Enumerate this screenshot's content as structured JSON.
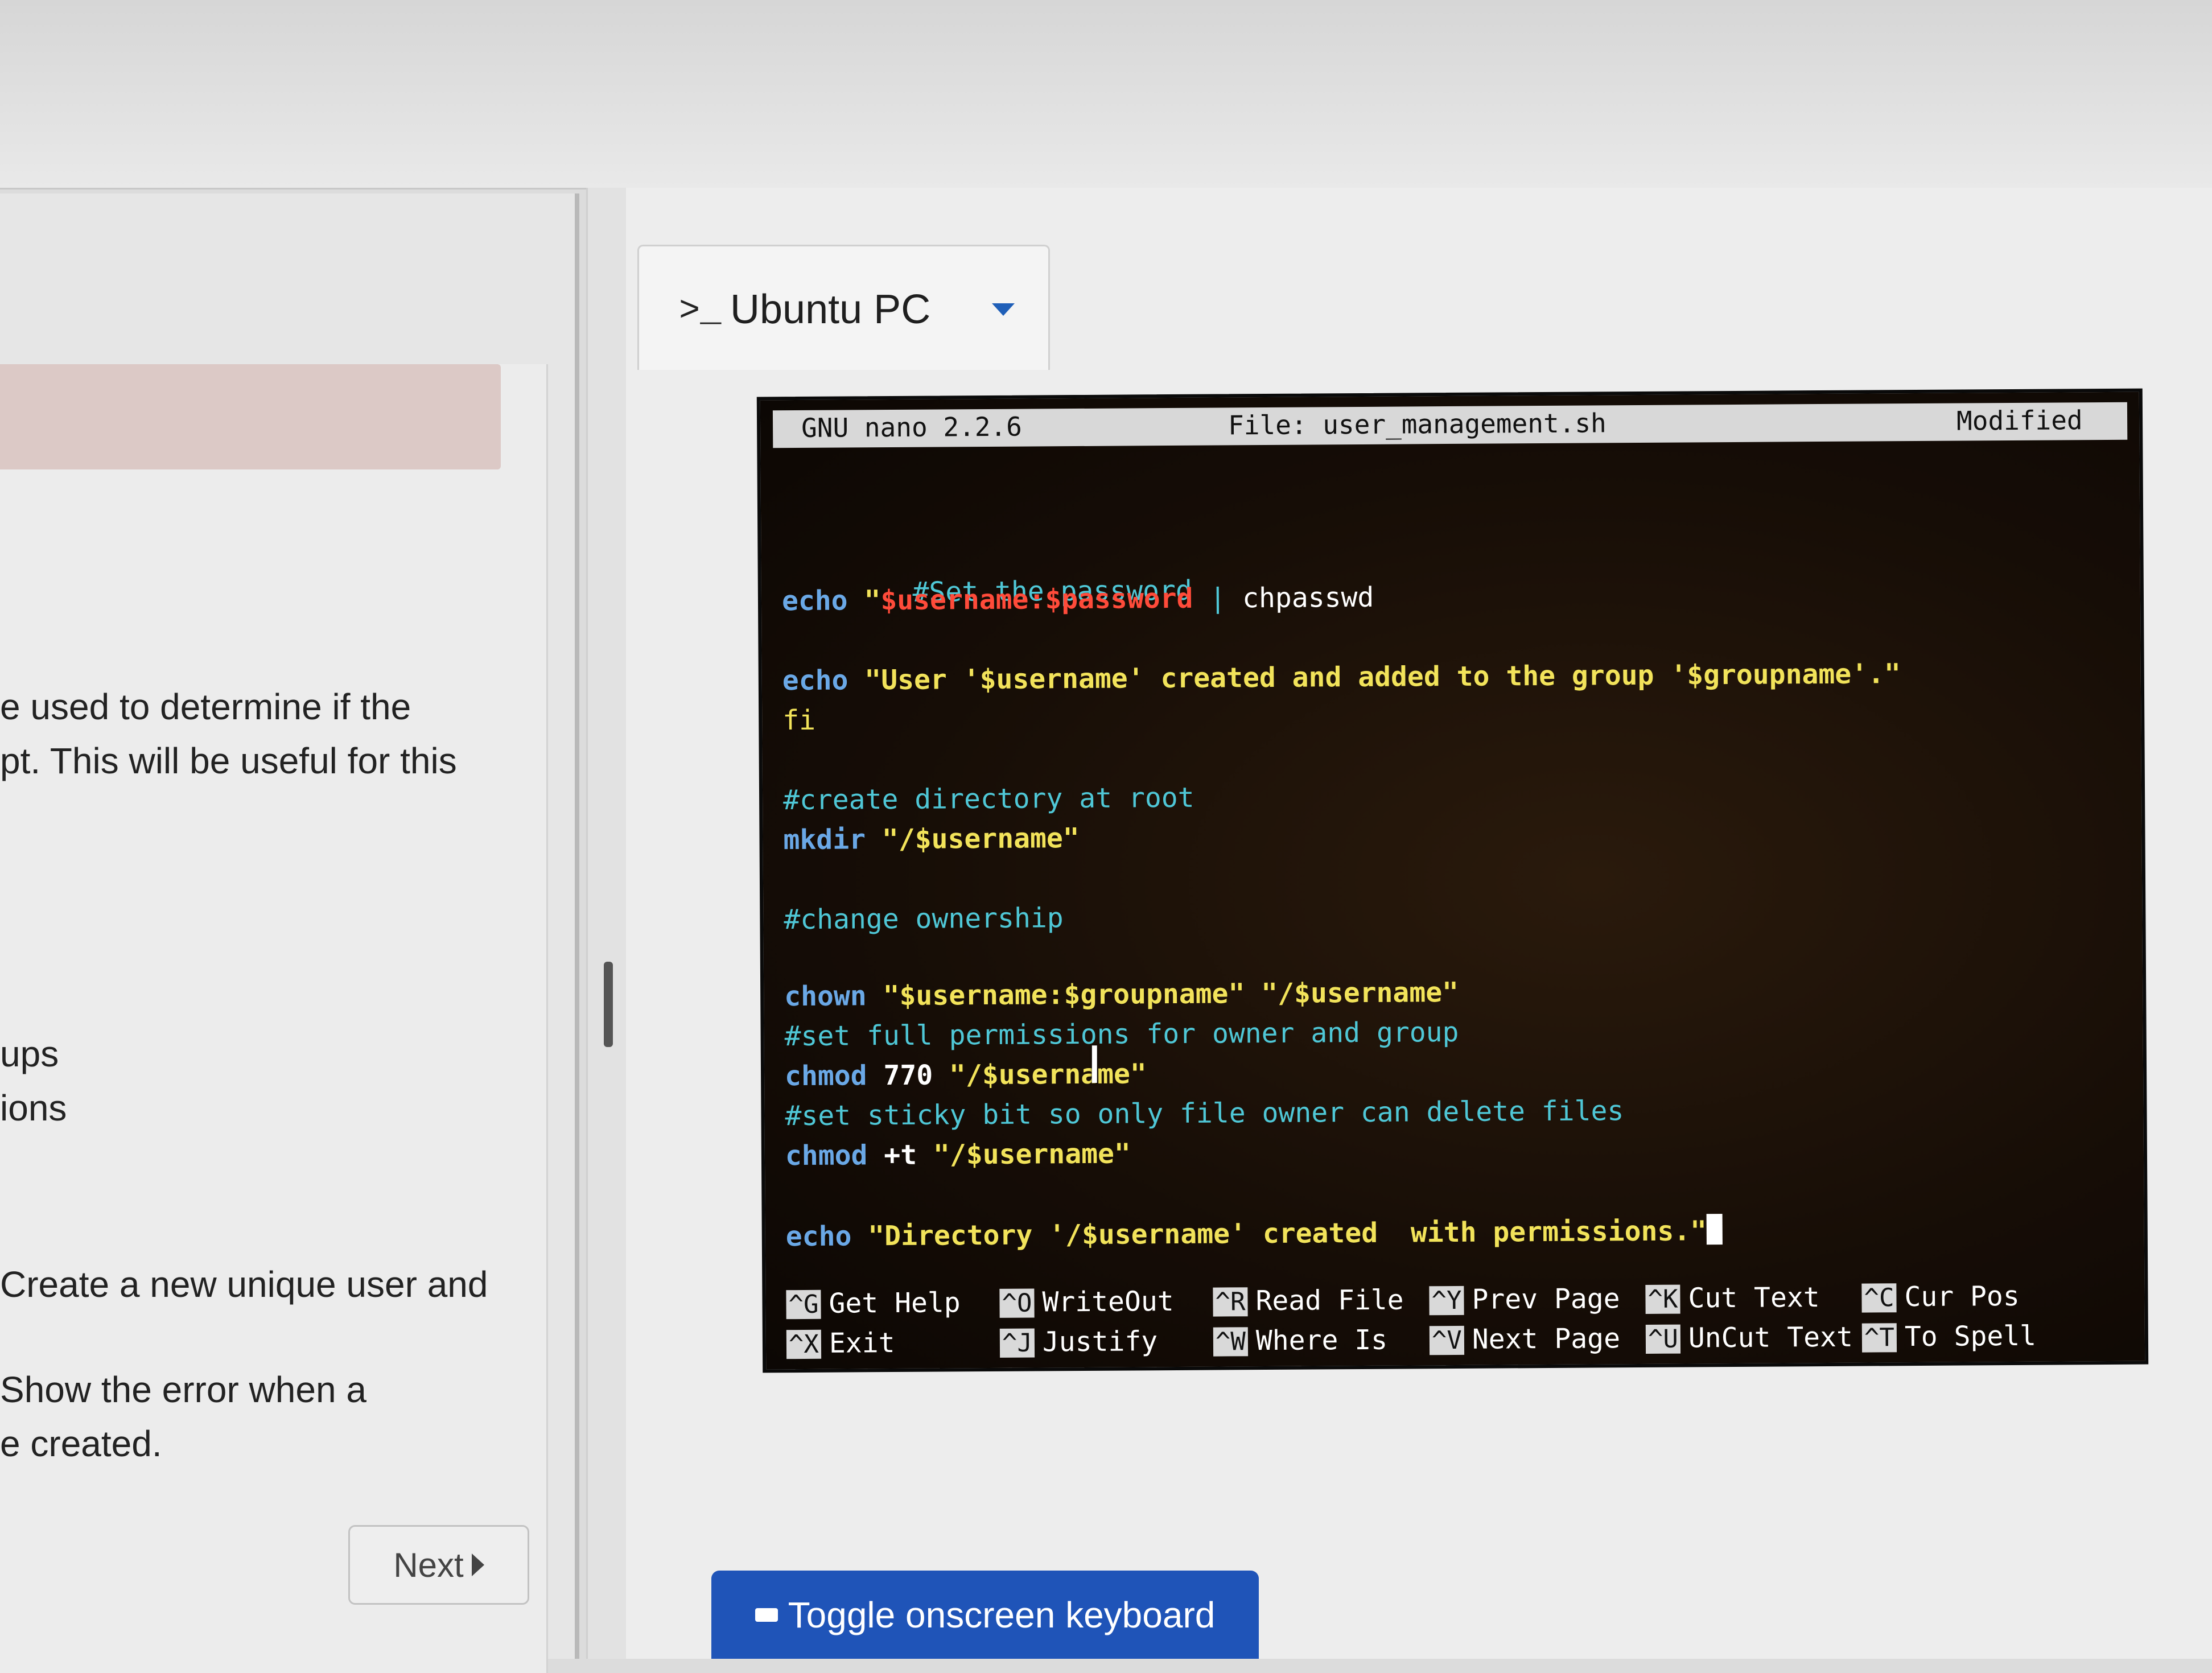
{
  "left_panel": {
    "text_lines": [
      "e used to determine if the",
      "pt. This will be useful for this",
      "ups",
      "ions",
      "Create a new unique user and",
      "Show the error when a",
      "e created."
    ],
    "next_label": "Next"
  },
  "tab": {
    "prompt_icon": ">_",
    "title": "Ubuntu PC"
  },
  "nano": {
    "version": "GNU nano 2.2.6",
    "file": "File: user_management.sh",
    "status": "Modified"
  },
  "code": {
    "l1": "#Set the password",
    "l2_kw": "echo",
    "l2_q": "\"",
    "l2_var": "$username:$password",
    "l2_pipe": " | ",
    "l2_cmd": "chpasswd",
    "l3_kw": "echo",
    "l3_str": "\"User '$username' created and added to the group '$groupname'.\"",
    "l4": "fi",
    "l5": "#create directory at root",
    "l6_kw": "mkdir",
    "l6_str": "\"/$username\"",
    "l7": "#change ownership",
    "l8_kw": "chown",
    "l8_str": "\"$username:$groupname\" \"/$username\"",
    "l9": "#set full permissions for owner and group",
    "l10_kw": "chmod",
    "l10_num": "770",
    "l10_str": "\"/$username\"",
    "l11": "#set sticky bit so only file owner can delete files",
    "l12_kw": "chmod",
    "l12_arg": "+t",
    "l12_str": "\"/$username\"",
    "l13_kw": "echo",
    "l13_str": "\"Directory '/$username' created  with permissions.\""
  },
  "shortcuts": [
    {
      "key": "^G",
      "label": "Get Help"
    },
    {
      "key": "^O",
      "label": "WriteOut"
    },
    {
      "key": "^R",
      "label": "Read File"
    },
    {
      "key": "^Y",
      "label": "Prev Page"
    },
    {
      "key": "^K",
      "label": "Cut Text"
    },
    {
      "key": "^C",
      "label": "Cur Pos"
    },
    {
      "key": "^X",
      "label": "Exit"
    },
    {
      "key": "^J",
      "label": "Justify"
    },
    {
      "key": "^W",
      "label": "Where Is"
    },
    {
      "key": "^V",
      "label": "Next Page"
    },
    {
      "key": "^U",
      "label": "UnCut Text"
    },
    {
      "key": "^T",
      "label": "To Spell"
    }
  ],
  "toggle_keyboard_label": "Toggle onscreen keyboard"
}
